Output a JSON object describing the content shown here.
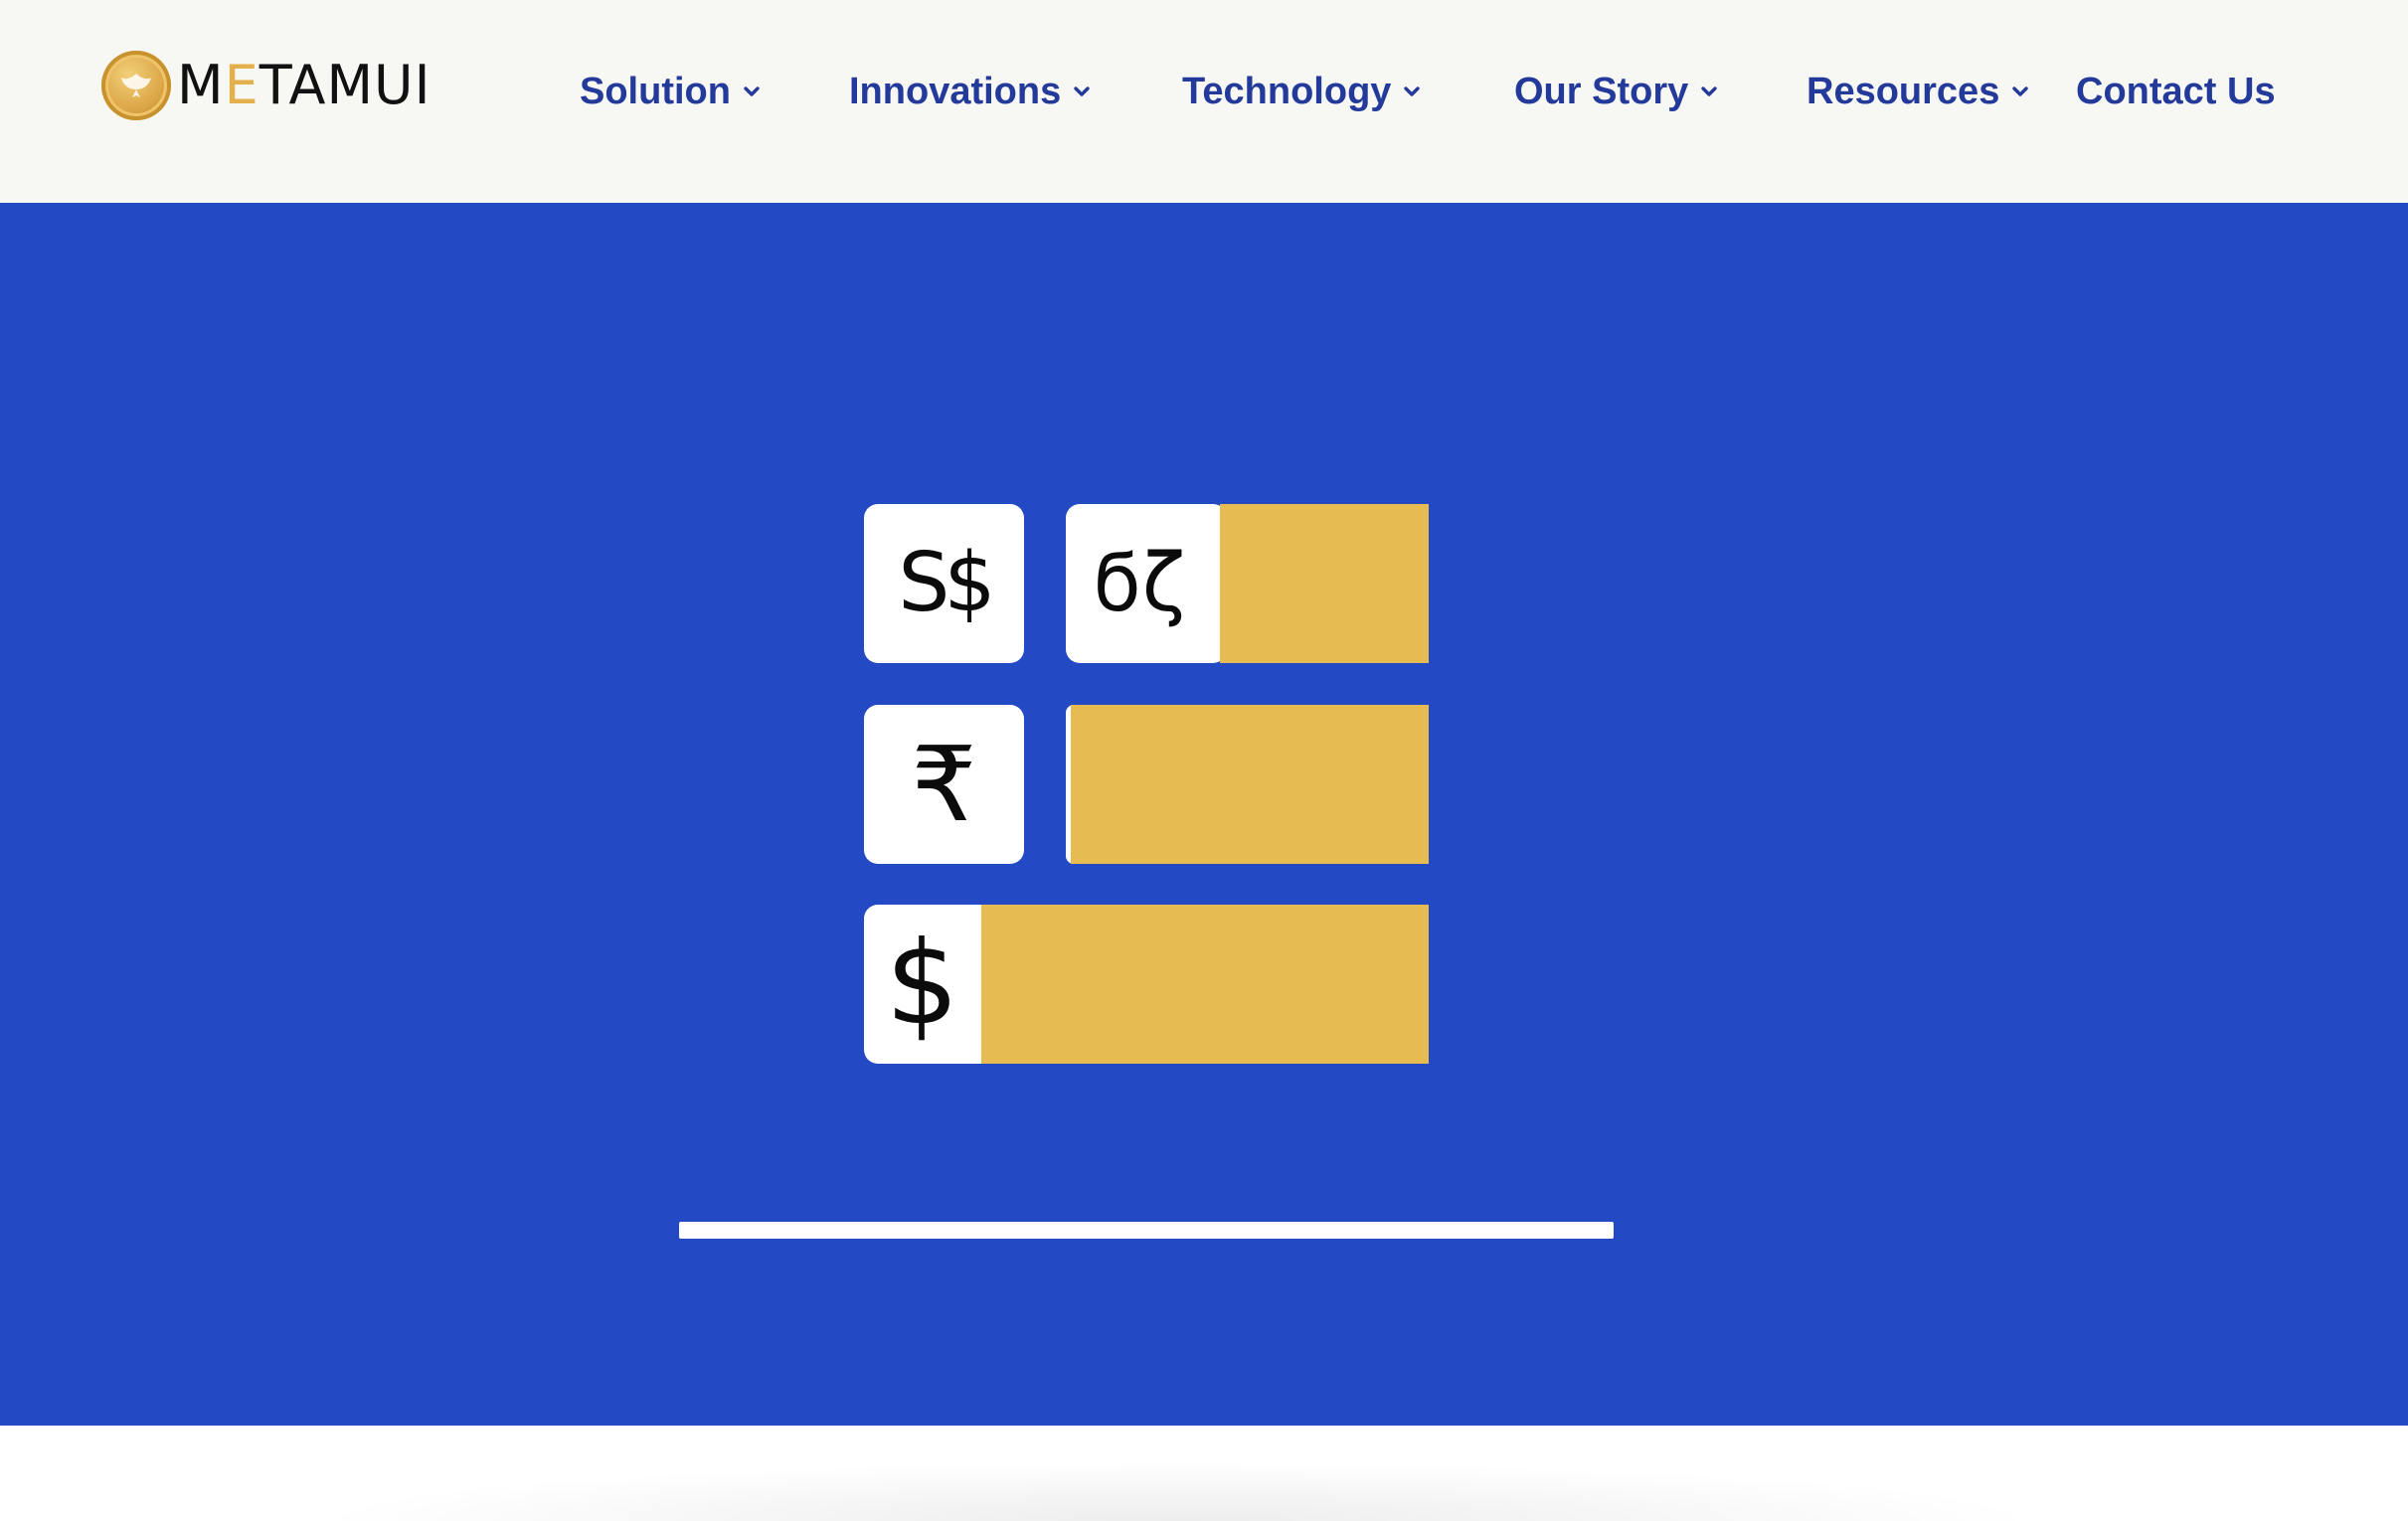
{
  "brand": {
    "wordmark_pre": "M",
    "wordmark_accent": "E",
    "wordmark_post": "TAMUI",
    "accent_color": "#e3b04b"
  },
  "nav": {
    "items": [
      {
        "label": "Solution",
        "has_dropdown": true
      },
      {
        "label": "Innovations",
        "has_dropdown": true
      },
      {
        "label": "Technology",
        "has_dropdown": true
      },
      {
        "label": "Our Story",
        "has_dropdown": true
      },
      {
        "label": "Resources",
        "has_dropdown": true
      },
      {
        "label": "Contact Us",
        "has_dropdown": false
      }
    ],
    "icon": "chevron-down-icon",
    "text_color": "#233a9b"
  },
  "hero": {
    "background": "#2349c4",
    "bar_color": "#e5bb52",
    "rows": [
      {
        "symbol": "S$",
        "currency": "singapore-dollar"
      },
      {
        "symbol": "ϭζ",
        "currency": "unknown-currency"
      },
      {
        "symbol": "₹",
        "currency": "indian-rupee"
      },
      {
        "symbol": "$",
        "currency": "us-dollar"
      }
    ]
  }
}
